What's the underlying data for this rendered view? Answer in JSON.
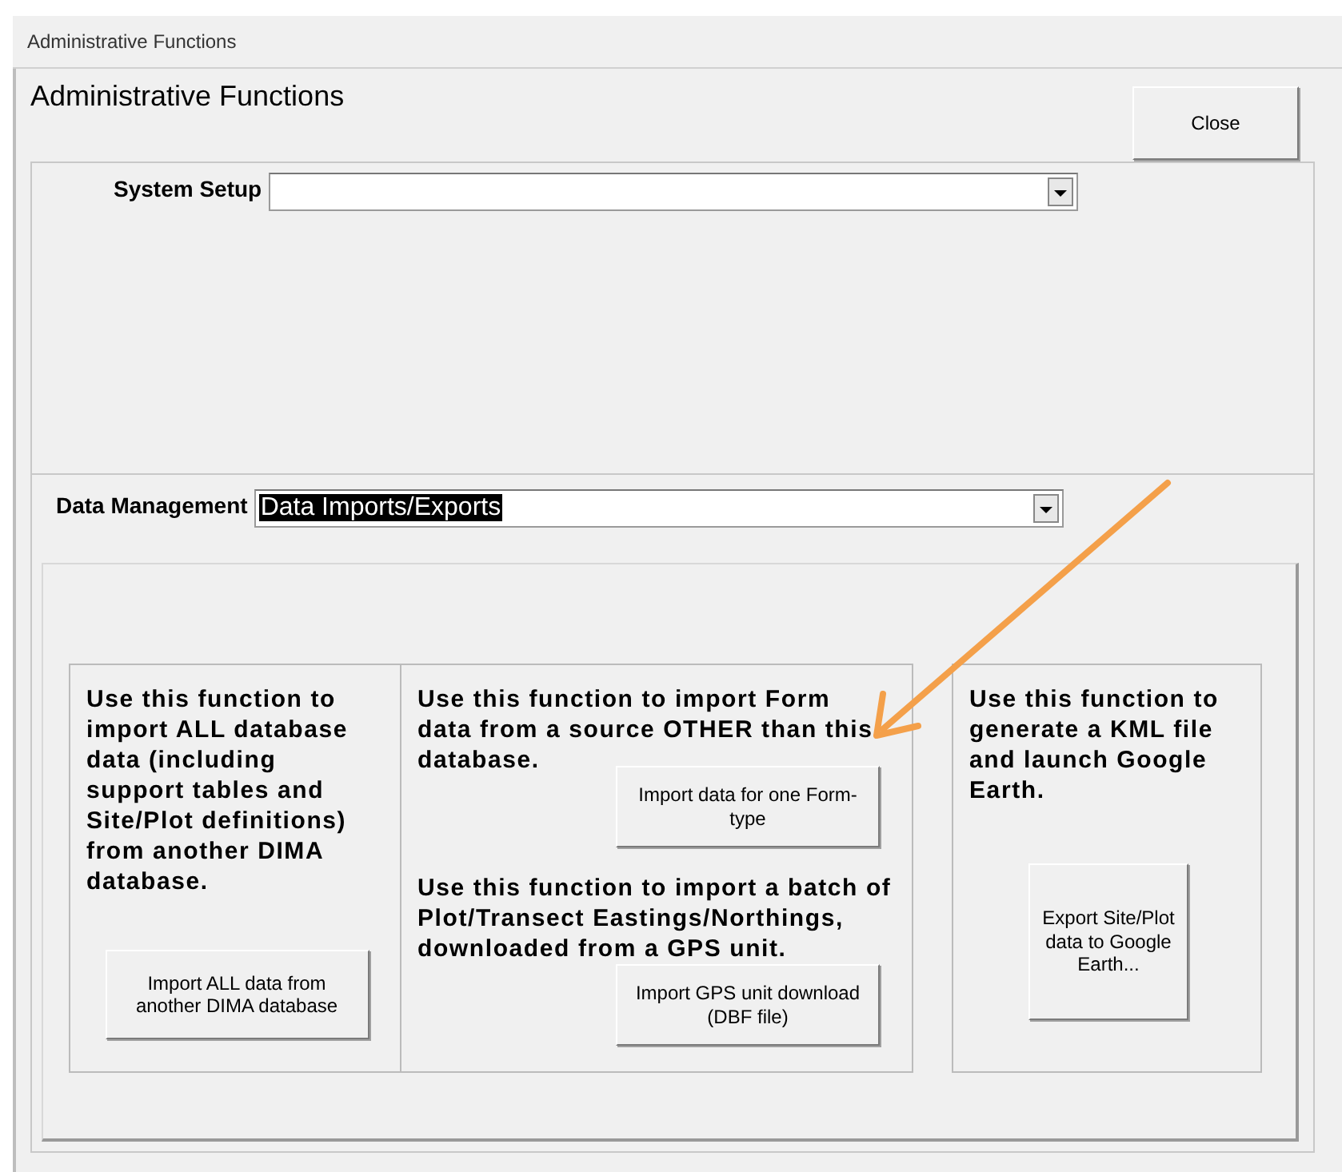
{
  "window": {
    "title": "Administrative Functions"
  },
  "heading": "Administrative Functions",
  "close_button": "Close",
  "system_setup": {
    "label": "System Setup"
  },
  "data_management": {
    "label": "Data Management",
    "value": "Data Imports/Exports",
    "highlighted": true
  },
  "sections": [
    {
      "blocks": [
        {
          "kind": "text",
          "text": "Use this function to import ALL database data (including support tables and Site/Plot definitions) from another DIMA database."
        },
        {
          "kind": "button",
          "label": "Import ALL data from another DIMA database"
        }
      ]
    },
    {
      "blocks": [
        {
          "kind": "text",
          "text": "Use this function to import Form data from a source OTHER than this database."
        },
        {
          "kind": "button",
          "label": "Import data for one Form-type"
        },
        {
          "kind": "text",
          "text": "Use this function to import a batch of Plot/Transect Eastings/Northings, downloaded from a GPS unit."
        },
        {
          "kind": "button",
          "label": "Import GPS unit download (DBF file)"
        }
      ]
    },
    {
      "blocks": [
        {
          "kind": "text",
          "text": "Use this function to generate a KML file and launch Google Earth."
        },
        {
          "kind": "button",
          "label": "Export Site/Plot data to Google Earth..."
        }
      ]
    }
  ]
}
